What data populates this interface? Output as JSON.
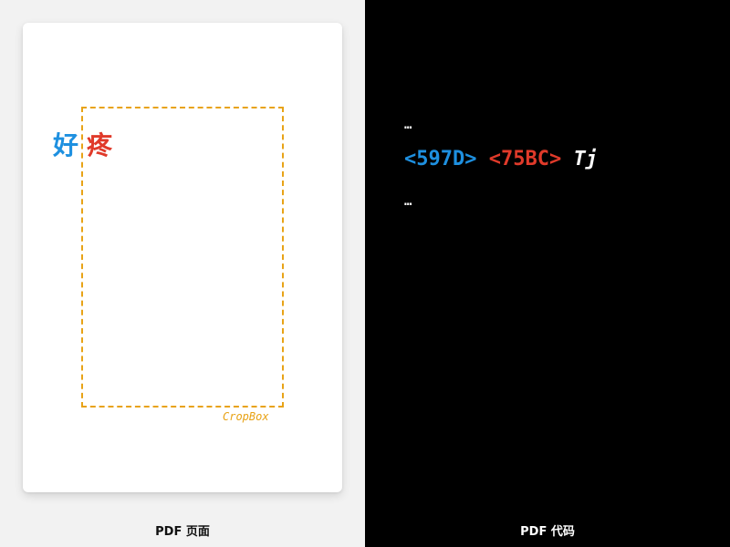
{
  "left": {
    "glyph_1": "好",
    "glyph_2": "疼",
    "cropbox_label": "CropBox",
    "caption": "PDF 页面"
  },
  "right": {
    "ellipsis_top": "…",
    "code": {
      "token_1": "<597D>",
      "token_2": "<75BC>",
      "operator": "Tj"
    },
    "ellipsis_bottom": "…",
    "caption": "PDF 代码"
  },
  "colors": {
    "blue": "#1e90e0",
    "red": "#e03a2a",
    "cropbox": "#e8a317",
    "code_background": "#000000",
    "page_background": "#ffffff"
  }
}
